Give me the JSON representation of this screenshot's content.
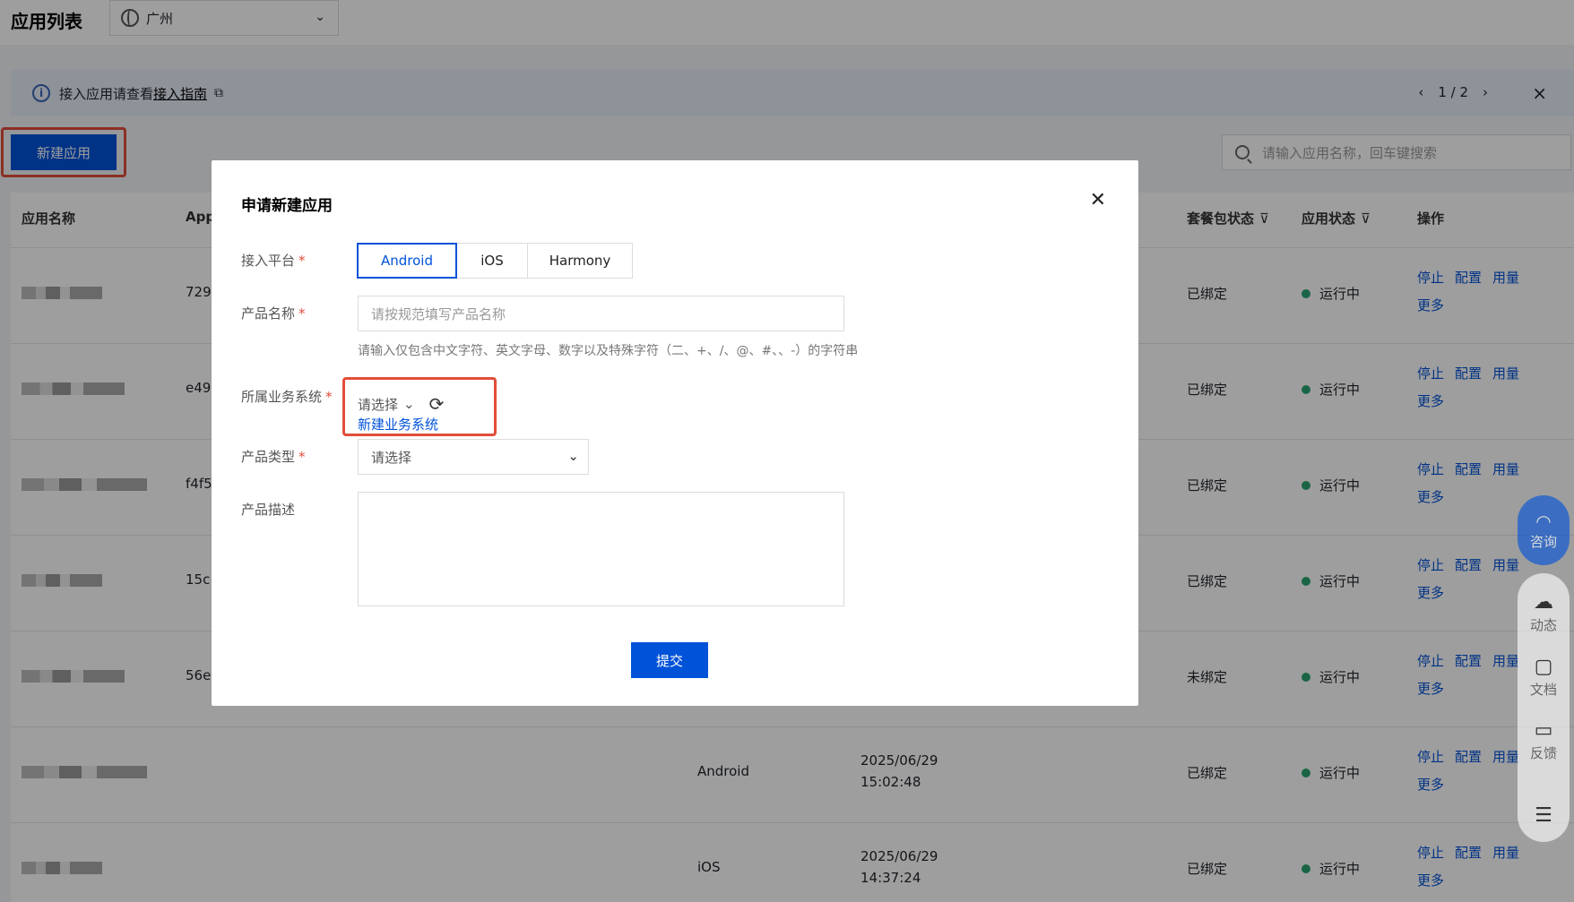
{
  "header": {
    "title": "应用列表",
    "region": "广州"
  },
  "notice": {
    "text": "接入应用请查看",
    "link": "接入指南",
    "pager": "1 / 2"
  },
  "toolbar": {
    "new_app": "新建应用",
    "search_placeholder": "请输入应用名称，回车键搜索"
  },
  "table": {
    "columns": {
      "name": "应用名称",
      "appid": "App",
      "pkg_status": "套餐包状态",
      "app_status": "应用状态",
      "ops": "操作"
    },
    "rows": [
      {
        "id": "729",
        "pkg": "已绑定",
        "status": "运行中",
        "platform": "",
        "date": "",
        "time": ""
      },
      {
        "id": "e49",
        "pkg": "已绑定",
        "status": "运行中",
        "platform": "",
        "date": "",
        "time": ""
      },
      {
        "id": "f4f5",
        "pkg": "已绑定",
        "status": "运行中",
        "platform": "",
        "date": "",
        "time": ""
      },
      {
        "id": "15c",
        "pkg": "已绑定",
        "status": "运行中",
        "platform": "",
        "date": "",
        "time": ""
      },
      {
        "id": "56e",
        "pkg": "未绑定",
        "status": "运行中",
        "platform": "",
        "date": "",
        "time": ""
      },
      {
        "id": "",
        "pkg": "已绑定",
        "status": "运行中",
        "platform": "Android",
        "date": "2025/06/29",
        "time": "15:02:48"
      },
      {
        "id": "",
        "pkg": "已绑定",
        "status": "运行中",
        "platform": "iOS",
        "date": "2025/06/29",
        "time": "14:37:24"
      }
    ],
    "ops": {
      "stop": "停止",
      "config": "配置",
      "usage": "用量",
      "more": "更多"
    }
  },
  "modal": {
    "title": "申请新建应用",
    "platform_label": "接入平台",
    "platforms": [
      "Android",
      "iOS",
      "Harmony"
    ],
    "name_label": "产品名称",
    "name_placeholder": "请按规范填写产品名称",
    "name_hint": "请输入仅包含中文字符、英文字母、数字以及特殊字符（二、+、/、@、#、、-）的字符串",
    "biz_label": "所属业务系统",
    "biz_select": "请选择",
    "biz_new": "新建业务系统",
    "type_label": "产品类型",
    "type_select": "请选择",
    "desc_label": "产品描述",
    "submit": "提交"
  },
  "sidebar": {
    "consult": "咨询",
    "activity": "动态",
    "docs": "文档",
    "feedback": "反馈"
  },
  "colors": {
    "primary": "#0052d9",
    "highlight": "#e34d3a",
    "running": "#2ba471"
  }
}
